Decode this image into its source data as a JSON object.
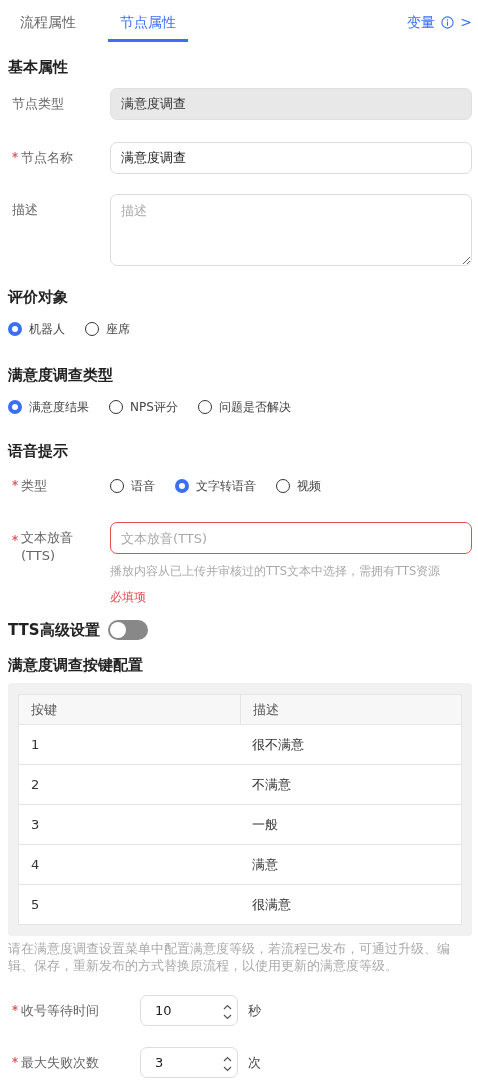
{
  "tabs": [
    {
      "label": "流程属性",
      "selected": false
    },
    {
      "label": "节点属性",
      "selected": true
    }
  ],
  "variables_link": {
    "label": "变量",
    "arrow": ">"
  },
  "basic": {
    "title": "基本属性",
    "fields": [
      {
        "kind": "input",
        "label": "节点类型",
        "required": false,
        "value": "满意度调查",
        "disabled": true
      },
      {
        "kind": "input",
        "label": "节点名称",
        "required": true,
        "value": "满意度调查",
        "disabled": false
      },
      {
        "kind": "textarea",
        "label": "描述",
        "required": false,
        "placeholder": "描述"
      }
    ]
  },
  "evaluation": {
    "title": "评价对象",
    "options": [
      {
        "label": "机器人",
        "selected": true
      },
      {
        "label": "座席",
        "selected": false
      }
    ]
  },
  "survey_type": {
    "title": "满意度调查类型",
    "options": [
      {
        "label": "满意度结果",
        "selected": true
      },
      {
        "label": "NPS评分",
        "selected": false
      },
      {
        "label": "问题是否解决",
        "selected": false
      }
    ]
  },
  "voice": {
    "title": "语音提示",
    "type_field": {
      "label": "类型",
      "required": true,
      "options": [
        {
          "label": "语音",
          "selected": false
        },
        {
          "label": "文字转语音",
          "selected": true
        },
        {
          "label": "视频",
          "selected": false
        }
      ]
    },
    "tts_field": {
      "label": "文本放音(TTS)",
      "required": true,
      "placeholder": "文本放音(TTS)",
      "invalid": true,
      "hint": "播放内容从已上传并审核过的TTS文本中选择，需拥有TTS资源",
      "error": "必填项"
    }
  },
  "tts_advanced": {
    "label": "TTS高级设置",
    "on": false
  },
  "key_config": {
    "title": "满意度调查按键配置",
    "columns": [
      "按键",
      "描述"
    ],
    "rows": [
      [
        "1",
        "很不满意"
      ],
      [
        "2",
        "不满意"
      ],
      [
        "3",
        "一般"
      ],
      [
        "4",
        "满意"
      ],
      [
        "5",
        "很满意"
      ]
    ],
    "note": "请在满意度调查设置菜单中配置满意度等级，若流程已发布，可通过升级、编辑、保存，重新发布的方式替换原流程，以使用更新的满意度等级。"
  },
  "number_fields": [
    {
      "label": "收号等待时间",
      "required": true,
      "value": "10",
      "unit": "秒"
    },
    {
      "label": "最大失败次数",
      "required": true,
      "value": "3",
      "unit": "次"
    }
  ]
}
